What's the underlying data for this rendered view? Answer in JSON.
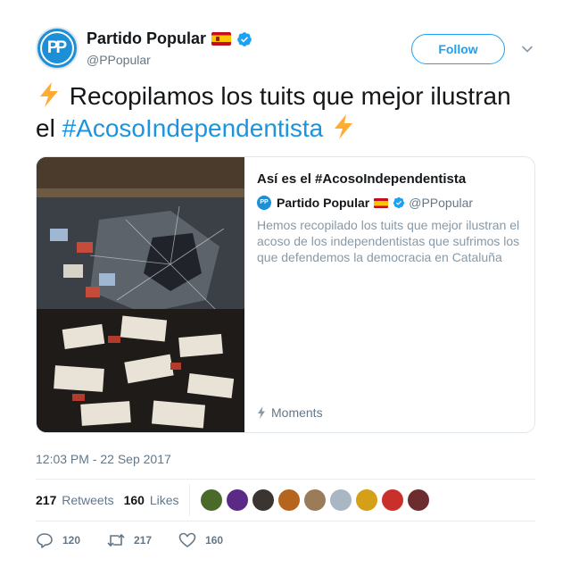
{
  "header": {
    "avatar_text": "PP",
    "display_name": "Partido Popular",
    "handle": "@PPopular",
    "follow_label": "Follow"
  },
  "tweet": {
    "text_before": "Recopilamos los tuits que mejor ilustran el ",
    "hashtag": "#AcosoIndependentista"
  },
  "card": {
    "title": "Así es el #AcosoIndependentista",
    "author_name": "Partido Popular",
    "author_handle": "@PPopular",
    "description": "Hemos recopilado los tuits que mejor ilustran el acoso de los independentistas que sufrimos los que defendemos la democracia en Cataluña",
    "footer_label": "Moments"
  },
  "timestamp": "12:03 PM - 22 Sep 2017",
  "stats": {
    "retweets_count": "217",
    "retweets_label": "Retweets",
    "likes_count": "160",
    "likes_label": "Likes",
    "liker_avatars": [
      "#4a6a2a",
      "#5b2a86",
      "#3a3530",
      "#b5651d",
      "#9a7b5a",
      "#a9b6c4",
      "#d4a017",
      "#c9302c",
      "#6b2d2d"
    ]
  },
  "actions": {
    "replies": "120",
    "retweets": "217",
    "likes": "160"
  },
  "colors": {
    "link": "#1b95e0",
    "follow": "#1da1f2",
    "muted": "#657786",
    "verified": "#1da1f2"
  }
}
